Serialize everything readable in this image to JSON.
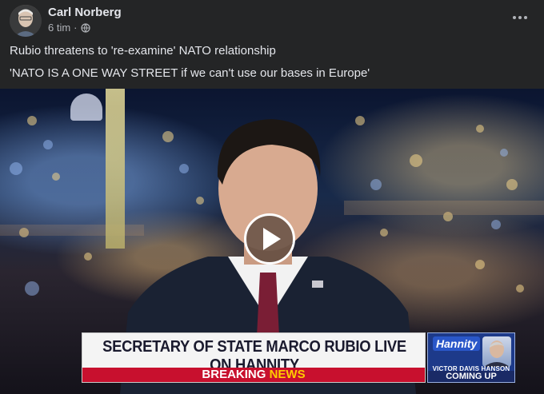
{
  "post": {
    "author": "Carl Norberg",
    "time": "6 tim",
    "separator": "·",
    "privacy_icon": "globe-icon",
    "more_icon": "ellipsis-icon",
    "text_line1": "Rubio threatens to 're-examine' NATO relationship",
    "text_line2": "'NATO IS A ONE WAY STREET if we can't use our bases in Europe'"
  },
  "video": {
    "play_icon": "play-icon",
    "chyron": {
      "title": "SECRETARY OF STATE MARCO RUBIO LIVE ON HANNITY",
      "breaking": "BREAKING",
      "news": "NEWS"
    },
    "promo": {
      "logo": "Hannity",
      "name": "VICTOR DAVIS HANSON",
      "coming": "COMING UP"
    }
  },
  "colors": {
    "background": "#242526",
    "text_primary": "#e4e6eb",
    "text_secondary": "#b0b3b8",
    "breaking_red": "#c8102e",
    "news_yellow": "#ffcc00"
  }
}
